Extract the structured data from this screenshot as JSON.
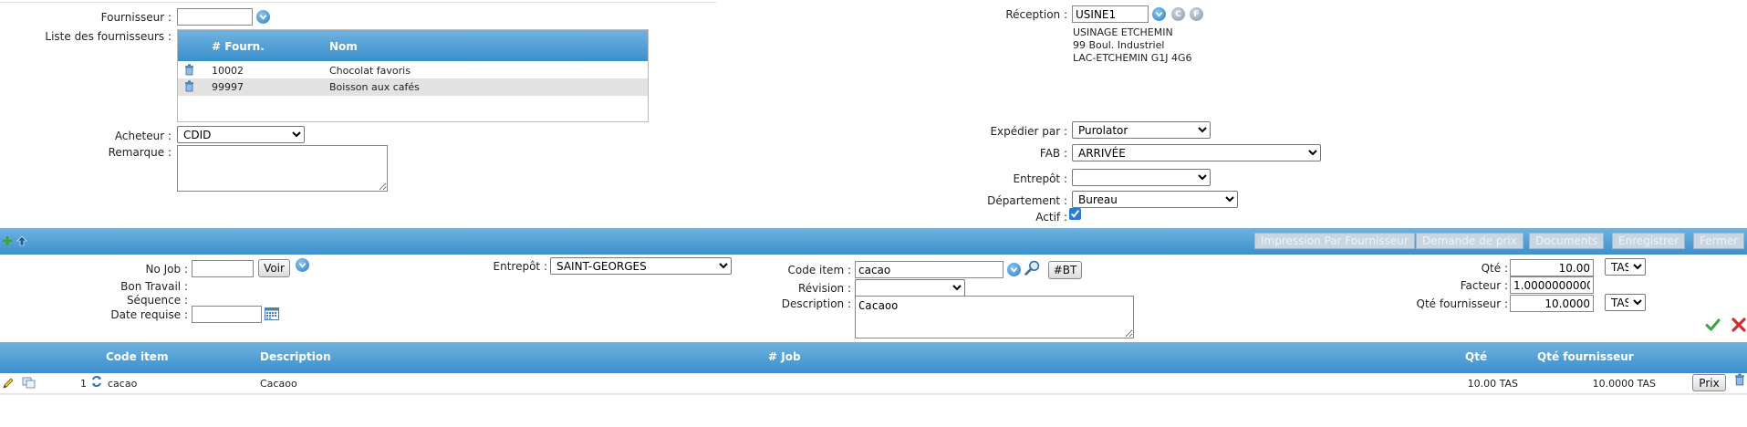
{
  "supplier": {
    "label": "Fournisseur :",
    "value": "",
    "list_label": "Liste des fournisseurs :",
    "list_headers": [
      "# Fourn.",
      "Nom"
    ],
    "list_rows": [
      {
        "id": "10002",
        "name": "Chocolat favoris"
      },
      {
        "id": "99997",
        "name": "Boisson aux cafés"
      }
    ]
  },
  "buyer": {
    "label": "Acheteur :",
    "value": "CDID"
  },
  "remark": {
    "label": "Remarque :",
    "value": ""
  },
  "reception": {
    "label": "Réception :",
    "value": "USINE1",
    "btn_c": "C",
    "btn_f": "F",
    "address": [
      "USINAGE ETCHEMIN",
      "99 Boul. Industriel",
      "LAC-ETCHEMIN  G1J 4G6"
    ]
  },
  "ship_via": {
    "label": "Expédier par :",
    "value": "Purolator"
  },
  "fob": {
    "label": "FAB :",
    "value": "ARRIVÉE"
  },
  "warehouse_top": {
    "label": "Entrepôt :",
    "value": ""
  },
  "department": {
    "label": "Département :",
    "value": "Bureau"
  },
  "active": {
    "label": "Actif :",
    "checked": true
  },
  "toolbar": {
    "buttons": [
      "Impression Par Fournisseur",
      "Demande de prix",
      "Documents",
      "Enregistrer",
      "Fermer"
    ]
  },
  "line_form": {
    "job_label": "No Job :",
    "job_value": "",
    "view_button": "Voir",
    "work_order_label": "Bon Travail :",
    "sequence_label": "Séquence :",
    "date_label": "Date requise :",
    "date_value": "",
    "warehouse_label": "Entrepôt :",
    "warehouse_value": "SAINT-GEORGES",
    "item_label": "Code item :",
    "item_value": "cacao",
    "bt_button": "#BT",
    "revision_label": "Révision :",
    "revision_value": "",
    "description_label": "Description :",
    "description_value": "Cacaoo",
    "qty_label": "Qté :",
    "qty_value": "10.00",
    "qty_unit": "TAS",
    "factor_label": "Facteur :",
    "factor_value": "1.0000000000",
    "supplier_qty_label": "Qté fournisseur :",
    "supplier_qty_value": "10.0000",
    "supplier_qty_unit": "TAS"
  },
  "lines_table": {
    "headers": [
      "Code item",
      "Description",
      "# Job",
      "Qté",
      "Qté fournisseur"
    ],
    "rows": [
      {
        "num": "1",
        "item": "cacao",
        "description": "Cacaoo",
        "job": "",
        "qty": "10.00 TAS",
        "supplier_qty": "10.0000 TAS",
        "price_button": "Prix"
      }
    ]
  },
  "colors": {
    "accent": "#3b8fcc",
    "header_grad_top": "#6fb3e0"
  }
}
